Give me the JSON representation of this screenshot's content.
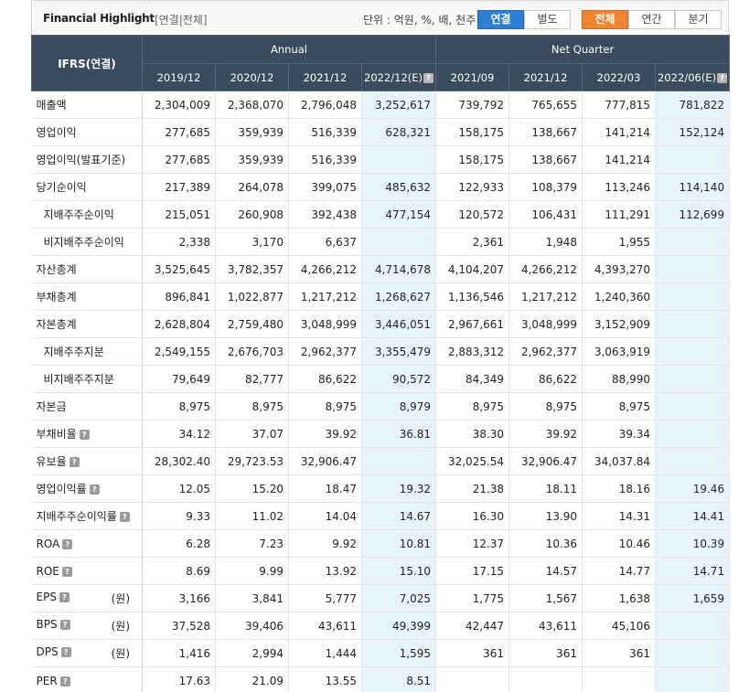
{
  "header": {
    "title": "Financial Highlight",
    "subtitle": "[연결|전체]",
    "unit_text": "단위 : 억원, %, 배, 천주",
    "buttons": {
      "consolidated": "연결",
      "separate": "별도",
      "all": "전체",
      "annual": "연간",
      "quarter": "분기"
    },
    "help_glyph": "?"
  },
  "table": {
    "corner_label": "IFRS(연결)",
    "group_annual": "Annual",
    "group_quarter": "Net Quarter",
    "columns": [
      "2019/12",
      "2020/12",
      "2021/12",
      "2022/12(E)",
      "2021/09",
      "2021/12",
      "2022/03",
      "2022/06(E)"
    ],
    "rows": [
      {
        "label": "매출액",
        "values": [
          "2,304,009",
          "2,368,070",
          "2,796,048",
          "3,252,617",
          "739,792",
          "765,655",
          "777,815",
          "781,822"
        ]
      },
      {
        "label": "영업이익",
        "values": [
          "277,685",
          "359,939",
          "516,339",
          "628,321",
          "158,175",
          "138,667",
          "141,214",
          "152,124"
        ]
      },
      {
        "label": "영업이익(발표기준)",
        "values": [
          "277,685",
          "359,939",
          "516,339",
          "",
          "158,175",
          "138,667",
          "141,214",
          ""
        ]
      },
      {
        "label": "당기순이익",
        "values": [
          "217,389",
          "264,078",
          "399,075",
          "485,632",
          "122,933",
          "108,379",
          "113,246",
          "114,140"
        ]
      },
      {
        "label": "지배주주순이익",
        "values": [
          "215,051",
          "260,908",
          "392,438",
          "477,154",
          "120,572",
          "106,431",
          "111,291",
          "112,699"
        ]
      },
      {
        "label": "비지배주주순이익",
        "values": [
          "2,338",
          "3,170",
          "6,637",
          "",
          "2,361",
          "1,948",
          "1,955",
          ""
        ]
      },
      {
        "label": "자산총계",
        "values": [
          "3,525,645",
          "3,782,357",
          "4,266,212",
          "4,714,678",
          "4,104,207",
          "4,266,212",
          "4,393,270",
          ""
        ]
      },
      {
        "label": "부채총계",
        "values": [
          "896,841",
          "1,022,877",
          "1,217,212",
          "1,268,627",
          "1,136,546",
          "1,217,212",
          "1,240,360",
          ""
        ]
      },
      {
        "label": "자본총계",
        "values": [
          "2,628,804",
          "2,759,480",
          "3,048,999",
          "3,446,051",
          "2,967,661",
          "3,048,999",
          "3,152,909",
          ""
        ]
      },
      {
        "label": "지배주주지분",
        "values": [
          "2,549,155",
          "2,676,703",
          "2,962,377",
          "3,355,479",
          "2,883,312",
          "2,962,377",
          "3,063,919",
          ""
        ]
      },
      {
        "label": "비지배주주지분",
        "values": [
          "79,649",
          "82,777",
          "86,622",
          "90,572",
          "84,349",
          "86,622",
          "88,990",
          ""
        ]
      },
      {
        "label": "자본금",
        "values": [
          "8,975",
          "8,975",
          "8,975",
          "8,979",
          "8,975",
          "8,975",
          "8,975",
          ""
        ]
      },
      {
        "label": "부채비율",
        "values": [
          "34.12",
          "37.07",
          "39.92",
          "36.81",
          "38.30",
          "39.92",
          "39.34",
          ""
        ]
      },
      {
        "label": "유보율",
        "values": [
          "28,302.40",
          "29,723.53",
          "32,906.47",
          "",
          "32,025.54",
          "32,906.47",
          "34,037.84",
          ""
        ]
      },
      {
        "label": "영업이익률",
        "values": [
          "12.05",
          "15.20",
          "18.47",
          "19.32",
          "21.38",
          "18.11",
          "18.16",
          "19.46"
        ]
      },
      {
        "label": "지배주주순이익률",
        "values": [
          "9.33",
          "11.02",
          "14.04",
          "14.67",
          "16.30",
          "13.90",
          "14.31",
          "14.41"
        ]
      },
      {
        "label": "ROA",
        "values": [
          "6.28",
          "7.23",
          "9.92",
          "10.81",
          "12.37",
          "10.36",
          "10.46",
          "10.39"
        ]
      },
      {
        "label": "ROE",
        "values": [
          "8.69",
          "9.99",
          "13.92",
          "15.10",
          "17.15",
          "14.57",
          "14.77",
          "14.71"
        ]
      },
      {
        "label": "EPS",
        "unit": "(원)",
        "values": [
          "3,166",
          "3,841",
          "5,777",
          "7,025",
          "1,775",
          "1,567",
          "1,638",
          "1,659"
        ]
      },
      {
        "label": "BPS",
        "unit": "(원)",
        "values": [
          "37,528",
          "39,406",
          "43,611",
          "49,399",
          "42,447",
          "43,611",
          "45,106",
          ""
        ]
      },
      {
        "label": "DPS",
        "unit": "(원)",
        "values": [
          "1,416",
          "2,994",
          "1,444",
          "1,595",
          "361",
          "361",
          "361",
          ""
        ]
      },
      {
        "label": "PER",
        "values": [
          "17.63",
          "21.09",
          "13.55",
          "8.51",
          "",
          "",
          "",
          ""
        ]
      }
    ]
  },
  "colors": {
    "header_bg": "#3a4b5e",
    "estimate_bg": "#e8f4fb",
    "active_blue": "#2e7fd4",
    "active_orange": "#f08430"
  }
}
